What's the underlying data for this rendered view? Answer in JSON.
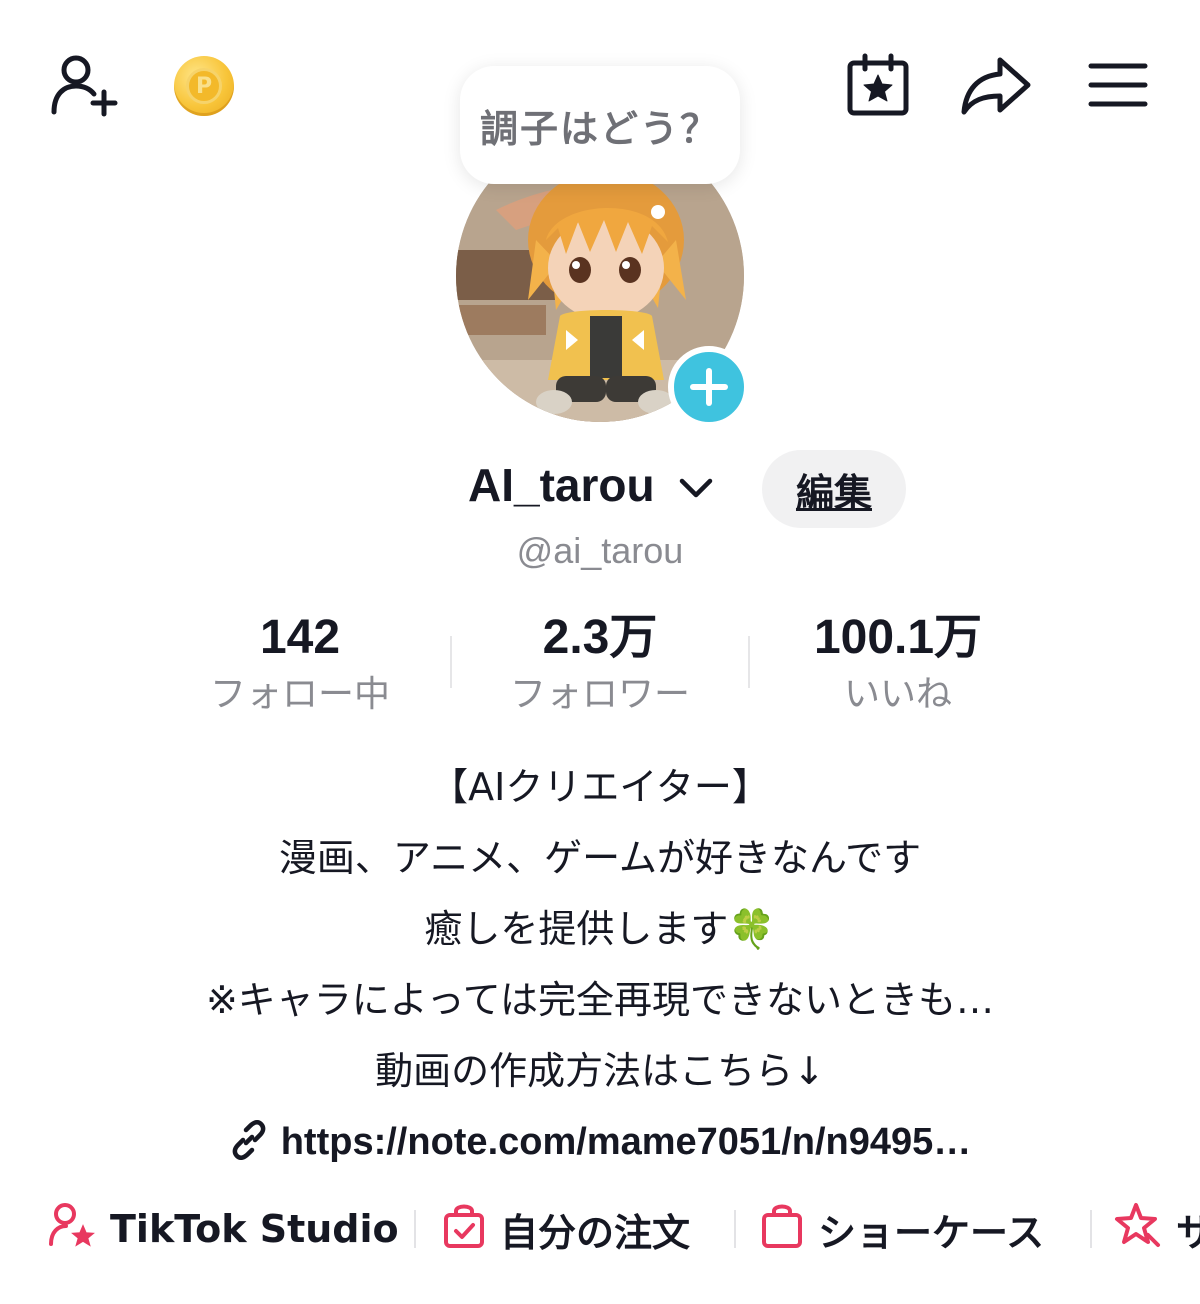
{
  "topbar": {
    "add_friend_icon": "person-add-icon",
    "coin_icon": "coin-icon",
    "coin_letter": "P",
    "calendar_icon": "calendar-star-icon",
    "share_icon": "share-arrow-icon",
    "menu_icon": "hamburger-menu-icon"
  },
  "status_bubble": {
    "text": "調子はどう？"
  },
  "profile": {
    "username": "AI_tarou",
    "handle": "@ai_tarou",
    "edit_label": "編集"
  },
  "stats": [
    {
      "value": "142",
      "label": "フォロー中"
    },
    {
      "value": "2.3万",
      "label": "フォロワー"
    },
    {
      "value": "100.1万",
      "label": "いいね"
    }
  ],
  "bio": {
    "lines": [
      "【AIクリエイター】",
      "漫画、アニメ、ゲームが好きなんです",
      "癒しを提供します🍀",
      "※キャラによっては完全再現できないときも…",
      "動画の作成方法はこちら↓"
    ],
    "link": "https://note.com/mame7051/n/n9495…"
  },
  "shortcuts": [
    {
      "label": "TikTok Studio",
      "icon": "creator-star-icon"
    },
    {
      "label": "自分の注文",
      "icon": "order-bag-icon"
    },
    {
      "label": "ショーケース",
      "icon": "shopping-bag-icon"
    },
    {
      "label": "サ",
      "icon": "sparkle-icon"
    }
  ],
  "colors": {
    "accent_pink": "#e8385f",
    "plus_badge": "#3fc3df",
    "coin_gold": "#f8c53a"
  }
}
